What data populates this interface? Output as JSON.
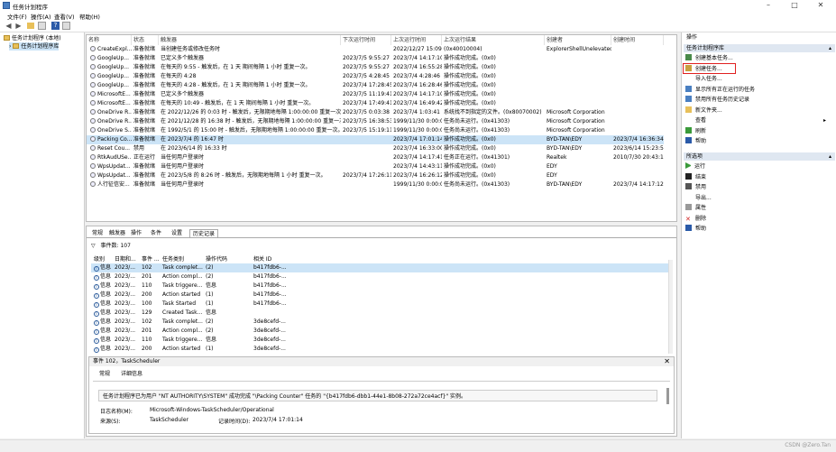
{
  "window": {
    "title": "任务计划程序"
  },
  "menu": [
    "文件(F)",
    "操作(A)",
    "查看(V)",
    "帮助(H)"
  ],
  "tree": {
    "root": "任务计划程序 (本地)",
    "child": "任务计划程序库"
  },
  "tasklist": {
    "columns": [
      "名称",
      "状态",
      "触发器",
      "下次运行时间",
      "上次运行时间",
      "上次运行结果",
      "创建者",
      "创建时间"
    ],
    "rows": [
      [
        "CreateExpl...",
        "准备就绪",
        "当创建任务或修改任务时",
        "",
        "2022/12/27 15:09:29",
        "(0x40010004)",
        "ExplorerShellUnelevated",
        ""
      ],
      [
        "GoogleUp...",
        "准备就绪",
        "已定义多个触发器",
        "2023/7/5 9:55:27",
        "2023/7/4 14:17:10",
        "操作成功完成。(0x0)",
        "",
        ""
      ],
      [
        "GoogleUp...",
        "准备就绪",
        "在每天的 9:55 - 触发后，在 1 天 期间每隔 1 小时 重复一次。",
        "2023/7/5 9:55:27",
        "2023/7/4 16:55:28",
        "操作成功完成。(0x0)",
        "",
        ""
      ],
      [
        "GoogleUp...",
        "准备就绪",
        "在每天的 4:28",
        "2023/7/5 4:28:45",
        "2023/7/4 4:28:46",
        "操作成功完成。(0x0)",
        "",
        ""
      ],
      [
        "GoogleUp...",
        "准备就绪",
        "在每天的 4:28 - 触发后，在 1 天 期间每隔 1 小时 重复一次。",
        "2023/7/4 17:28:45",
        "2023/7/4 16:28:46",
        "操作成功完成。(0x0)",
        "",
        ""
      ],
      [
        "MicrosoftE...",
        "准备就绪",
        "已定义多个触发器",
        "2023/7/5 11:19:41",
        "2023/7/4 14:17:10",
        "操作成功完成。(0x0)",
        "",
        ""
      ],
      [
        "MicrosoftE...",
        "准备就绪",
        "在每天的 10:49 - 触发后，在 1 天 期间每隔 1 小时 重复一次。",
        "2023/7/4 17:49:41",
        "2023/7/4 16:49:42",
        "操作成功完成。(0x0)",
        "",
        ""
      ],
      [
        "OneDrive R...",
        "准备就绪",
        "在 2022/12/26 的 0:03 时 - 触发后，无限期地每隔 1:00:00:00 重复一次。",
        "2023/7/5 0:03:38",
        "2023/7/4 1:03:41",
        "系统找不到指定的文件。(0x80070002)",
        "Microsoft Corporation",
        ""
      ],
      [
        "OneDrive R...",
        "准备就绪",
        "在 2021/12/28 的 16:38 时 - 触发后，无限期地每隔 1:00:00:00 重复一次。",
        "2023/7/5 16:38:53",
        "1999/11/30 0:00:00",
        "任务尚未运行。(0x41303)",
        "Microsoft Corporation",
        ""
      ],
      [
        "OneDrive S...",
        "准备就绪",
        "在 1992/5/1 的 15:00 时 - 触发后，无限期地每隔 1:00:00:00 重复一次。",
        "2023/7/5 15:19:11",
        "1999/11/30 0:00:00",
        "任务尚未运行。(0x41303)",
        "Microsoft Corporation",
        ""
      ],
      [
        "Packing Co...",
        "准备就绪",
        "在 2023/7/4 的 16:47 时",
        "",
        "2023/7/4 17:01:14",
        "操作成功完成。(0x0)",
        "BYD-TAN\\EDY",
        "2023/7/4 16:36:34"
      ],
      [
        "Reset Cou...",
        "禁用",
        "在 2023/6/14 的 16:33 时",
        "",
        "2023/7/4 16:33:00",
        "操作成功完成。(0x0)",
        "BYD-TAN\\EDY",
        "2023/6/14 15:23:59"
      ],
      [
        "RtkAudUSe...",
        "正在运行",
        "当任何用户登录时",
        "",
        "2023/7/4 14:17:41",
        "任务正在运行。(0x41301)",
        "Realtek",
        "2010/7/30 20:43:10"
      ],
      [
        "WpsUpdat...",
        "准备就绪",
        "当任何用户登录时",
        "",
        "2023/7/4 14:43:11",
        "操作成功完成。(0x0)",
        "EDY",
        ""
      ],
      [
        "WpsUpdat...",
        "准备就绪",
        "在 2023/5/8 的 8:26 时 - 触发后，无限期地每隔 1 小时 重复一次。",
        "2023/7/4 17:26:11",
        "2023/7/4 16:26:12",
        "操作成功完成。(0x0)",
        "EDY",
        ""
      ],
      [
        "人行征信安...",
        "准备就绪",
        "当任何用户登录时",
        "",
        "1999/11/30 0:00:00",
        "任务尚未运行。(0x41303)",
        "BYD-TAN\\EDY",
        "2023/7/4 14:17:12"
      ]
    ]
  },
  "detail": {
    "tabs": [
      "常规",
      "触发器",
      "操作",
      "条件",
      "设置",
      "历史记录"
    ],
    "event_count": "事件数: 107",
    "history_columns": [
      "级别",
      "日期和...",
      "事件 ...",
      "任务类别",
      "操作代码",
      "相关 ID"
    ],
    "history_rows": [
      [
        "信息",
        "2023/...",
        "102",
        "Task complet...",
        "(2)",
        "b417fdb6-..."
      ],
      [
        "信息",
        "2023/...",
        "201",
        "Action compl...",
        "(2)",
        "b417fdb6-..."
      ],
      [
        "信息",
        "2023/...",
        "110",
        "Task triggere...",
        "信息",
        "b417fdb6-..."
      ],
      [
        "信息",
        "2023/...",
        "200",
        "Action started",
        "(1)",
        "b417fdb6-..."
      ],
      [
        "信息",
        "2023/...",
        "100",
        "Task Started",
        "(1)",
        "b417fdb6-..."
      ],
      [
        "信息",
        "2023/...",
        "129",
        "Created Task...",
        "信息",
        ""
      ],
      [
        "信息",
        "2023/...",
        "102",
        "Task complet...",
        "(2)",
        "3de8cefd-..."
      ],
      [
        "信息",
        "2023/...",
        "201",
        "Action compl...",
        "(2)",
        "3de8cefd-..."
      ],
      [
        "信息",
        "2023/...",
        "110",
        "Task triggere...",
        "信息",
        "3de8cefd-..."
      ],
      [
        "信息",
        "2023/...",
        "200",
        "Action started",
        "(1)",
        "3de8cefd-..."
      ]
    ],
    "event": {
      "header": "事件 102，TaskScheduler",
      "tabs": [
        "常规",
        "详细信息"
      ],
      "message": "任务计划程序已为用户 \"NT AUTHORITY\\SYSTEM\" 成功完成 \"\\Packing Counter\" 任务的 \"{b417fdb6-dbb1-44e1-8b08-272a72ce4acf}\" 实例。",
      "log_name_label": "日志名称(M):",
      "log_name_value": "Microsoft-Windows-TaskScheduler/Operational",
      "source_label": "来源(S):",
      "source_value": "TaskScheduler",
      "logged_label": "记录时间(D):",
      "logged_value": "2023/7/4 17:01:14"
    }
  },
  "actions": {
    "title": "操作",
    "section1": "任务计划程序库",
    "items1": [
      "创建基本任务...",
      "创建任务...",
      "导入任务...",
      "显示所有正在运行的任务",
      "禁用所有任务历史记录",
      "新文件夹...",
      "查看",
      "刷新",
      "帮助"
    ],
    "section2": "所选项",
    "items2": [
      "运行",
      "结束",
      "禁用",
      "导出...",
      "属性",
      "删除",
      "帮助"
    ]
  },
  "watermark": "CSDN @Zero.Tan"
}
